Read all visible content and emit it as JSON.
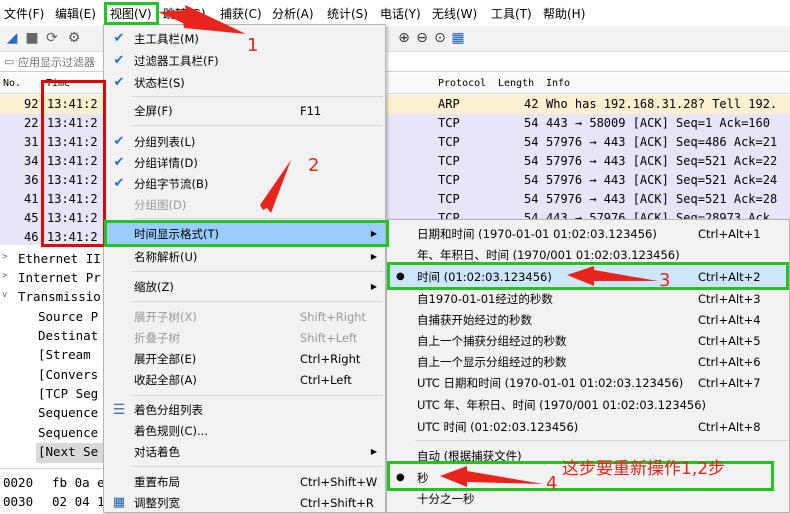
{
  "menubar": {
    "items": [
      "文件(F)",
      "编辑(E)",
      "视图(V)",
      "跳转(G)",
      "捕获(C)",
      "分析(A)",
      "统计(S)",
      "电话(Y)",
      "无线(W)",
      "工具(T)",
      "帮助(H)"
    ]
  },
  "filter": {
    "placeholder": "应用显示过滤器"
  },
  "packet_list": {
    "headers": {
      "no": "No.",
      "time": "Time",
      "protocol": "Protocol",
      "length": "Length",
      "info": "Info"
    },
    "rows": [
      {
        "no": "92",
        "time": "13:41:2",
        "protocol": "ARP",
        "length": "42",
        "info": "Who has 192.168.31.28? Tell 192."
      },
      {
        "no": "22",
        "time": "13:41:2",
        "protocol": "TCP",
        "length": "54",
        "info": "443 → 58009 [ACK] Seq=1 Ack=160"
      },
      {
        "no": "31",
        "time": "13:41:2",
        "protocol": "TCP",
        "length": "54",
        "info": "57976 → 443 [ACK] Seq=486 Ack=21"
      },
      {
        "no": "34",
        "time": "13:41:2",
        "protocol": "TCP",
        "length": "54",
        "info": "57976 → 443 [ACK] Seq=521 Ack=22"
      },
      {
        "no": "36",
        "time": "13:41:2",
        "protocol": "TCP",
        "length": "54",
        "info": "57976 → 443 [ACK] Seq=521 Ack=24"
      },
      {
        "no": "41",
        "time": "13:41:2",
        "protocol": "TCP",
        "length": "54",
        "info": "57976 → 443 [ACK] Seq=521 Ack=28"
      },
      {
        "no": "45",
        "time": "13:41:2",
        "protocol": "TCP",
        "length": "54",
        "info": "443 → 57976 [ACK] Seq=28973 Ack"
      },
      {
        "no": "46",
        "time": "13:41:2",
        "protocol": "",
        "length": "",
        "info": "8"
      }
    ]
  },
  "detail": {
    "lines": [
      "Ethernet II",
      "Internet Pr",
      "Transmissio",
      "Source P",
      "Destinat",
      "[Stream",
      "[Convers",
      "[TCP Seg",
      "Sequence",
      "Sequence",
      "[Next Se"
    ]
  },
  "bytes": {
    "lines": [
      {
        "offset": "0020",
        "hex": "fb 0a e"
      },
      {
        "offset": "0030",
        "hex": "02 04 1"
      }
    ]
  },
  "view_menu": {
    "items": [
      {
        "label": "主工具栏(M)",
        "checked": true
      },
      {
        "label": "过滤器工具栏(F)",
        "checked": true
      },
      {
        "label": "状态栏(S)",
        "checked": true
      },
      {
        "label": "全屏(F)",
        "shortcut": "F11"
      },
      {
        "label": "分组列表(L)",
        "checked": true
      },
      {
        "label": "分组详情(D)",
        "checked": true
      },
      {
        "label": "分组字节流(B)",
        "checked": true
      },
      {
        "label": "分组图(D)",
        "disabled": true
      },
      {
        "label": "时间显示格式(T)",
        "submenu": true
      },
      {
        "label": "名称解析(U)",
        "submenu": true
      },
      {
        "label": "缩放(Z)",
        "submenu": true
      },
      {
        "label": "展开子树(X)",
        "shortcut": "Shift+Right",
        "disabled": true
      },
      {
        "label": "折叠子树",
        "shortcut": "Shift+Left",
        "disabled": true
      },
      {
        "label": "展开全部(E)",
        "shortcut": "Ctrl+Right"
      },
      {
        "label": "收起全部(A)",
        "shortcut": "Ctrl+Left"
      },
      {
        "label": "着色分组列表"
      },
      {
        "label": "着色规则(C)..."
      },
      {
        "label": "对话着色",
        "submenu": true
      },
      {
        "label": "重置布局",
        "shortcut": "Ctrl+Shift+W"
      },
      {
        "label": "调整列宽",
        "shortcut": "Ctrl+Shift+R"
      }
    ]
  },
  "time_format_menu": {
    "items": [
      {
        "label": "日期和时间 (1970-01-01 01:02:03.123456)",
        "shortcut": "Ctrl+Alt+1"
      },
      {
        "label": "年、年积日、时间 (1970/001 01:02:03.123456)",
        "shortcut": ""
      },
      {
        "label": "时间 (01:02:03.123456)",
        "shortcut": "Ctrl+Alt+2",
        "selected": true
      },
      {
        "label": "自1970-01-01经过的秒数",
        "shortcut": "Ctrl+Alt+3"
      },
      {
        "label": "自捕获开始经过的秒数",
        "shortcut": "Ctrl+Alt+4"
      },
      {
        "label": "自上一个捕获分组经过的秒数",
        "shortcut": "Ctrl+Alt+5"
      },
      {
        "label": "自上一个显示分组经过的秒数",
        "shortcut": "Ctrl+Alt+6"
      },
      {
        "label": "UTC 日期和时间 (1970-01-01 01:02:03.123456)",
        "shortcut": "Ctrl+Alt+7"
      },
      {
        "label": "UTC 年、年积日、时间 (1970/001 01:02:03.123456)",
        "shortcut": ""
      },
      {
        "label": "UTC 时间 (01:02:03.123456)",
        "shortcut": "Ctrl+Alt+8"
      },
      {
        "label": "自动 (根据捕获文件)",
        "shortcut": ""
      },
      {
        "label": "秒",
        "shortcut": "",
        "selected": true
      },
      {
        "label": "十分之一秒",
        "shortcut": ""
      }
    ]
  },
  "annotations": {
    "step1": "1",
    "step2": "2",
    "step3": "3",
    "step4": "4",
    "note": "这步要重新操作1,2步"
  },
  "colors": {
    "annotation_red": "#e8251c",
    "annotation_box_red": "#e00000",
    "annotation_box_green": "#22c322",
    "menu_highlight": "#99ccff",
    "row_arp": "#fbf0cf",
    "row_tcp": "#e6e5fa"
  }
}
